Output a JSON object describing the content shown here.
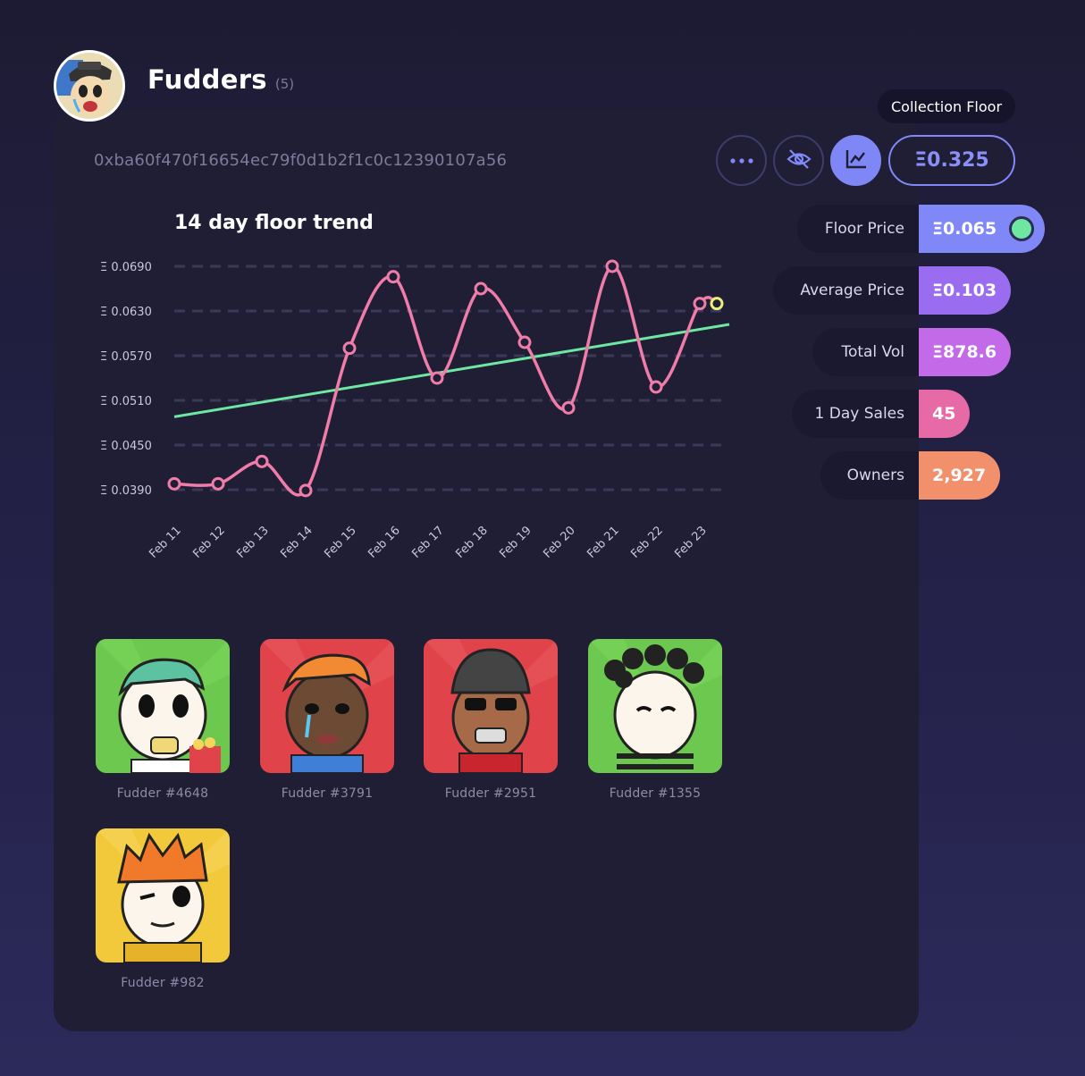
{
  "collection": {
    "title": "Fudders",
    "count": "(5)",
    "address": "0xba60f470f16654ec79f0d1b2f1c0c12390107a56"
  },
  "toolbar": {
    "more_icon": "more-dots-icon",
    "hide_icon": "eye-off-icon",
    "chart_icon": "line-chart-icon",
    "floor_value": "Ξ0.325",
    "tooltip": "Collection Floor"
  },
  "stats": [
    {
      "label": "Floor Price",
      "value": "Ξ0.065",
      "color": "#7f88f6"
    },
    {
      "label": "Average Price",
      "value": "Ξ0.103",
      "color": "#9a6cf0"
    },
    {
      "label": "Total Vol",
      "value": "Ξ878.6",
      "color": "#c36ae8"
    },
    {
      "label": "1 Day Sales",
      "value": "45",
      "color": "#e66aa6"
    },
    {
      "label": "Owners",
      "value": "2,927",
      "color": "#f1906a"
    }
  ],
  "chart_data": {
    "type": "line",
    "title": "14 day floor trend",
    "x": [
      "Feb 11",
      "Feb 12",
      "Feb 13",
      "Feb 14",
      "Feb 15",
      "Feb 16",
      "Feb 17",
      "Feb 18",
      "Feb 19",
      "Feb 20",
      "Feb 21",
      "Feb 22",
      "Feb 23"
    ],
    "series": [
      {
        "values": [
          0.0398,
          0.0398,
          0.0428,
          0.0389,
          0.058,
          0.0676,
          0.054,
          0.066,
          0.0588,
          0.05,
          0.069,
          0.0528,
          0.064,
          0.064
        ],
        "color": "#f07ca8"
      },
      {
        "type": "trend",
        "start": 0.0488,
        "end": 0.0612,
        "color": "#6ee7a2"
      }
    ],
    "yticks": [
      "Ξ 0.0690",
      "Ξ 0.0630",
      "Ξ 0.0570",
      "Ξ 0.0510",
      "Ξ 0.0450",
      "Ξ 0.0390"
    ],
    "ylim": [
      0.039,
      0.069
    ],
    "grid": true,
    "last_point_color": "#e9f07a"
  },
  "items": [
    {
      "name": "Fudder #4648",
      "bg": "#6cc84e"
    },
    {
      "name": "Fudder #3791",
      "bg": "#e0434a"
    },
    {
      "name": "Fudder #2951",
      "bg": "#e0434a"
    },
    {
      "name": "Fudder #1355",
      "bg": "#6cc84e"
    },
    {
      "name": "Fudder #982",
      "bg": "#f2c93a"
    }
  ]
}
